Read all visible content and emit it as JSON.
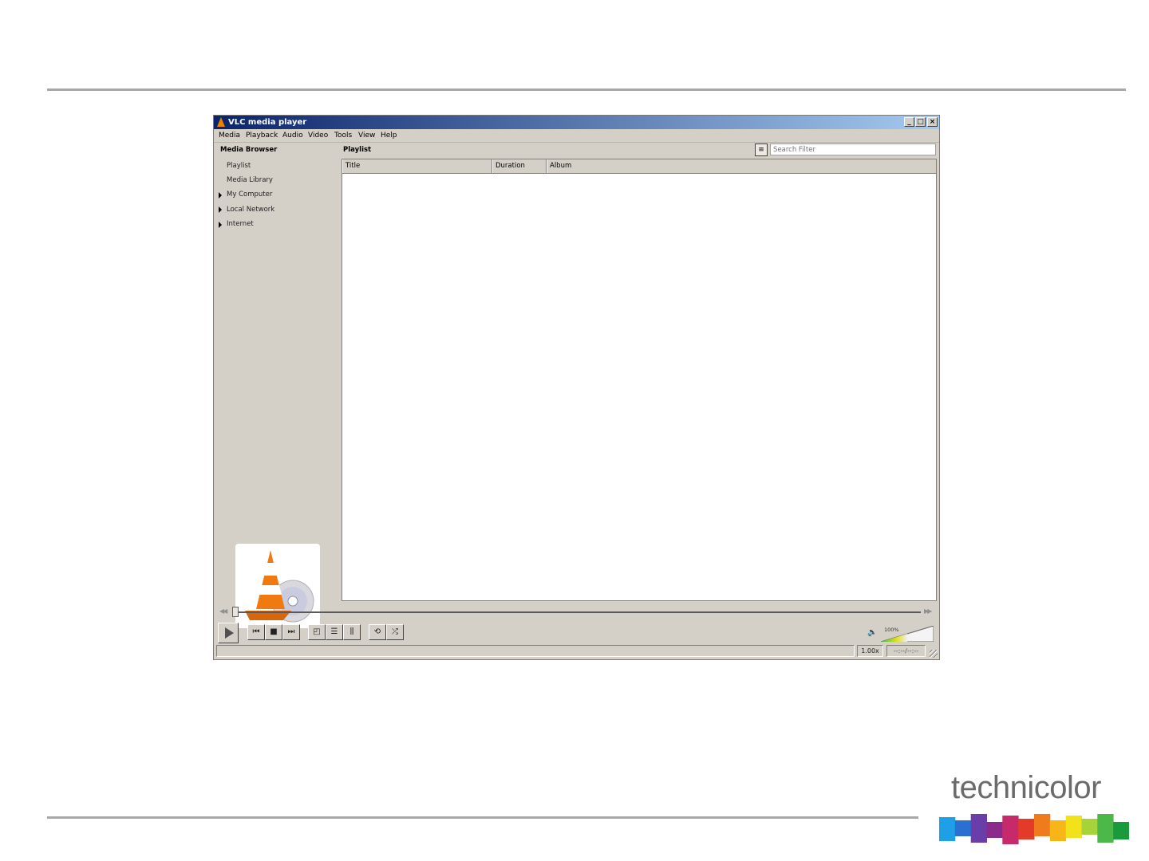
{
  "window": {
    "title": "VLC media player",
    "minimize_label": "_",
    "maximize_label": "□",
    "close_label": "×"
  },
  "menu": [
    "Media",
    "Playback",
    "Audio",
    "Video",
    "Tools",
    "View",
    "Help"
  ],
  "sidebar": {
    "heading": "Media Browser",
    "items": [
      {
        "label": "Playlist",
        "expandable": false
      },
      {
        "label": "Media Library",
        "expandable": false
      },
      {
        "label": "My Computer",
        "expandable": true
      },
      {
        "label": "Local Network",
        "expandable": true
      },
      {
        "label": "Internet",
        "expandable": true
      }
    ]
  },
  "playlist": {
    "label": "Playlist",
    "search_placeholder": "Search Filter",
    "columns": [
      "Title",
      "Duration",
      "Album"
    ]
  },
  "controls": {
    "volume_percent": "100%",
    "volume_level": 1.0,
    "speed": "1.00x",
    "time": "--:--/--:--"
  },
  "brand": {
    "name": "technicolor",
    "colors": [
      "#1ea0e6",
      "#2b6fd0",
      "#6a3ea8",
      "#8b2a8a",
      "#c62a6a",
      "#e43a2a",
      "#f07b1c",
      "#f7b518",
      "#f2e21a",
      "#a6d23a",
      "#4cb84a",
      "#1a9a3a"
    ]
  }
}
